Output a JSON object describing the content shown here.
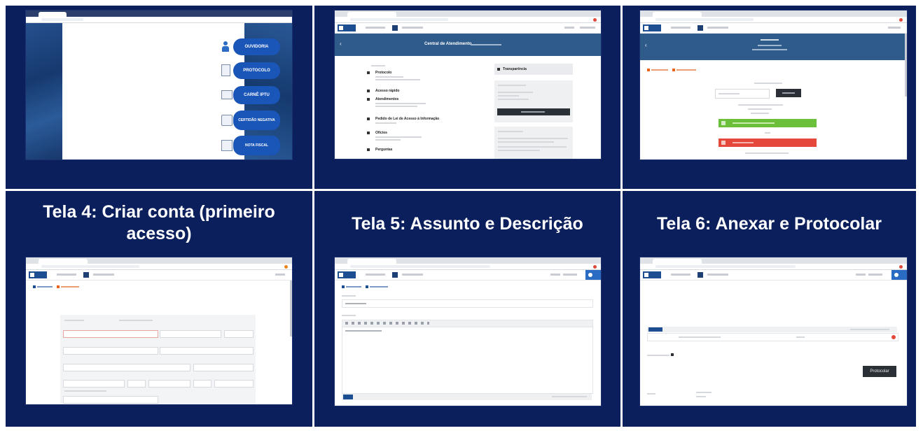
{
  "captions": {
    "tela4": "Tela 4: Criar conta (primeiro acesso)",
    "tela5": "Tela 5: Assunto e Descrição",
    "tela6": "Tela 6: Anexar e Protocolar"
  },
  "tela1": {
    "buttons": [
      "OUVIDORIA",
      "PROTOCOLO",
      "CARNÊ IPTU",
      "CERTIDÃO NEGATIVA",
      "NOTA FISCAL"
    ]
  },
  "tela2": {
    "title": "Central de Atendimento",
    "side_title": "Transparência",
    "menu": [
      "Protocolo",
      "Acesso rápido",
      "Atendimentos",
      "Pedido de Lei de Acesso à Informação",
      "Ofícios",
      "Perguntas"
    ]
  },
  "tela6": {
    "protocolar_label": "Protocolar"
  },
  "colors": {
    "cell_bg": "#0b1f5c",
    "accent_blue": "#2e5b8a",
    "green": "#6cbf3a",
    "red": "#e5483b"
  }
}
